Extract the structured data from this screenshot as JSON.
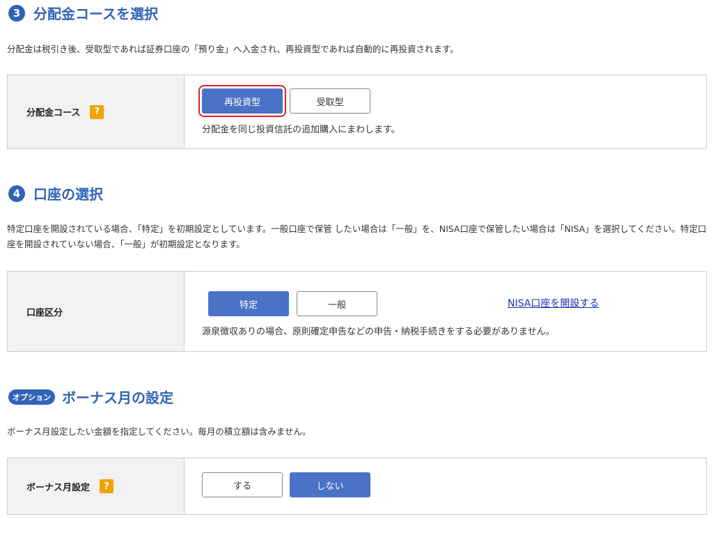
{
  "section3": {
    "number": "3",
    "title": "分配金コースを選択",
    "description": "分配金は税引き後、受取型であれば証券口座の「預り金」へ入金され、再投資型であれば自動的に再投資されます。",
    "row_label": "分配金コース",
    "help_icon": "?",
    "option_reinvest": "再投資型",
    "option_receive": "受取型",
    "helper_text": "分配金を同じ投資信託の追加購入にまわします。"
  },
  "section4": {
    "number": "4",
    "title": "口座の選択",
    "description": "特定口座を開設されている場合、「特定」を初期設定としています。一般口座で保管 したい場合は「一般」を、NISA口座で保管したい場合は「NISA」を選択してください。特定口座を開設されていない場合、「一般」が初期設定となります。",
    "row_label": "口座区分",
    "option_tokutei": "特定",
    "option_ippan": "一般",
    "nisa_link": "NISA口座を開設する",
    "helper_text": "源泉徴収ありの場合、原則確定申告などの申告・納税手続きをする必要がありません。"
  },
  "section_bonus": {
    "badge": "オプション",
    "title": "ボーナス月の設定",
    "description": "ボーナス月設定したい金額を指定してください。毎月の積立額は含みません。",
    "row_label": "ボーナス月設定",
    "help_icon": "?",
    "option_yes": "する",
    "option_no": "しない"
  },
  "colors": {
    "accent": "#2f63b6",
    "button_selected": "#4a72c6",
    "help_icon": "#f0a400",
    "highlight": "#e02020",
    "link": "#1a2fb0"
  }
}
